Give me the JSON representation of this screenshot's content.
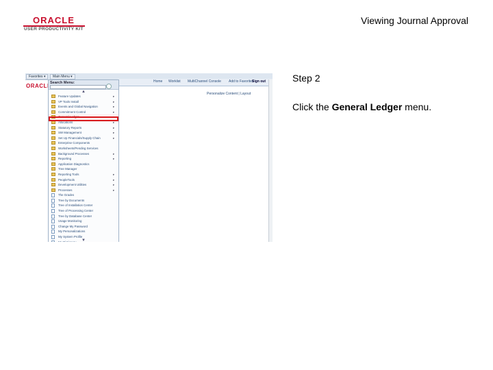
{
  "header": {
    "logo_text": "ORACLE",
    "logo_subtext": "USER PRODUCTIVITY KIT",
    "page_title": "Viewing Journal Approval"
  },
  "step": {
    "label": "Step 2",
    "instruction_prefix": "Click the ",
    "instruction_target": "General Ledger",
    "instruction_suffix": " menu."
  },
  "screenshot": {
    "top_tabs": [
      "Favorites ▾",
      "Main Menu ▾"
    ],
    "logo_text": "ORACLE",
    "header_links": [
      "Home",
      "Worklist",
      "MultiChannel Console",
      "Add to Favorites",
      "Sign out"
    ],
    "personalize": "Personalize Content | Layout",
    "menu": {
      "title": "Search Menu:",
      "items": [
        {
          "label": "Feature Updates",
          "icon": "folder-icon",
          "arrow": true
        },
        {
          "label": "VP Tools Install",
          "icon": "folder-icon",
          "arrow": true
        },
        {
          "label": "Events and Global Navigation",
          "icon": "folder-icon",
          "arrow": true
        },
        {
          "label": "Commitment Control",
          "icon": "folder-icon",
          "arrow": true
        },
        {
          "label": "General Ledger",
          "icon": "folder-icon",
          "arrow": true,
          "highlight": true
        },
        {
          "label": "Allocations",
          "icon": "folder-icon",
          "arrow": true
        },
        {
          "label": "Statutory Reports",
          "icon": "folder-icon",
          "arrow": true
        },
        {
          "label": "SW Management",
          "icon": "folder-icon",
          "arrow": true
        },
        {
          "label": "Set Up Financials/Supply Chain",
          "icon": "folder-icon",
          "arrow": true
        },
        {
          "label": "Enterprise Components",
          "icon": "folder-icon",
          "arrow": false
        },
        {
          "label": "Worksheets/Pending Services",
          "icon": "folder-icon",
          "arrow": false
        },
        {
          "label": "Background Processes",
          "icon": "folder-icon",
          "arrow": true
        },
        {
          "label": "Reporting",
          "icon": "folder-icon",
          "arrow": true
        },
        {
          "label": "Application Diagnostics",
          "icon": "folder-icon",
          "arrow": false
        },
        {
          "label": "Tree Manager",
          "icon": "folder-icon",
          "arrow": false
        },
        {
          "label": "Reporting Tools",
          "icon": "folder-icon",
          "arrow": true
        },
        {
          "label": "PeopleTools",
          "icon": "folder-icon",
          "arrow": true
        },
        {
          "label": "Development Utilities",
          "icon": "folder-icon",
          "arrow": true
        },
        {
          "label": "Processes",
          "icon": "folder-icon",
          "arrow": true
        },
        {
          "label": "The Grades",
          "icon": "page-icon",
          "arrow": false
        },
        {
          "label": "Tree by Documents",
          "icon": "page-icon",
          "arrow": false
        },
        {
          "label": "Tree of Installation Center",
          "icon": "page-icon",
          "arrow": false
        },
        {
          "label": "Tree of Processing Center",
          "icon": "page-icon",
          "arrow": false
        },
        {
          "label": "Tree by Database Center",
          "icon": "page-icon",
          "arrow": false
        },
        {
          "label": "Usage Monitoring",
          "icon": "page-icon",
          "arrow": false
        },
        {
          "label": "Change My Password",
          "icon": "page-icon",
          "arrow": false
        },
        {
          "label": "My Personalizations",
          "icon": "page-icon",
          "arrow": false
        },
        {
          "label": "My System Profile",
          "icon": "page-icon",
          "arrow": false
        },
        {
          "label": "My Dictionary",
          "icon": "page-icon",
          "arrow": false
        }
      ]
    }
  }
}
